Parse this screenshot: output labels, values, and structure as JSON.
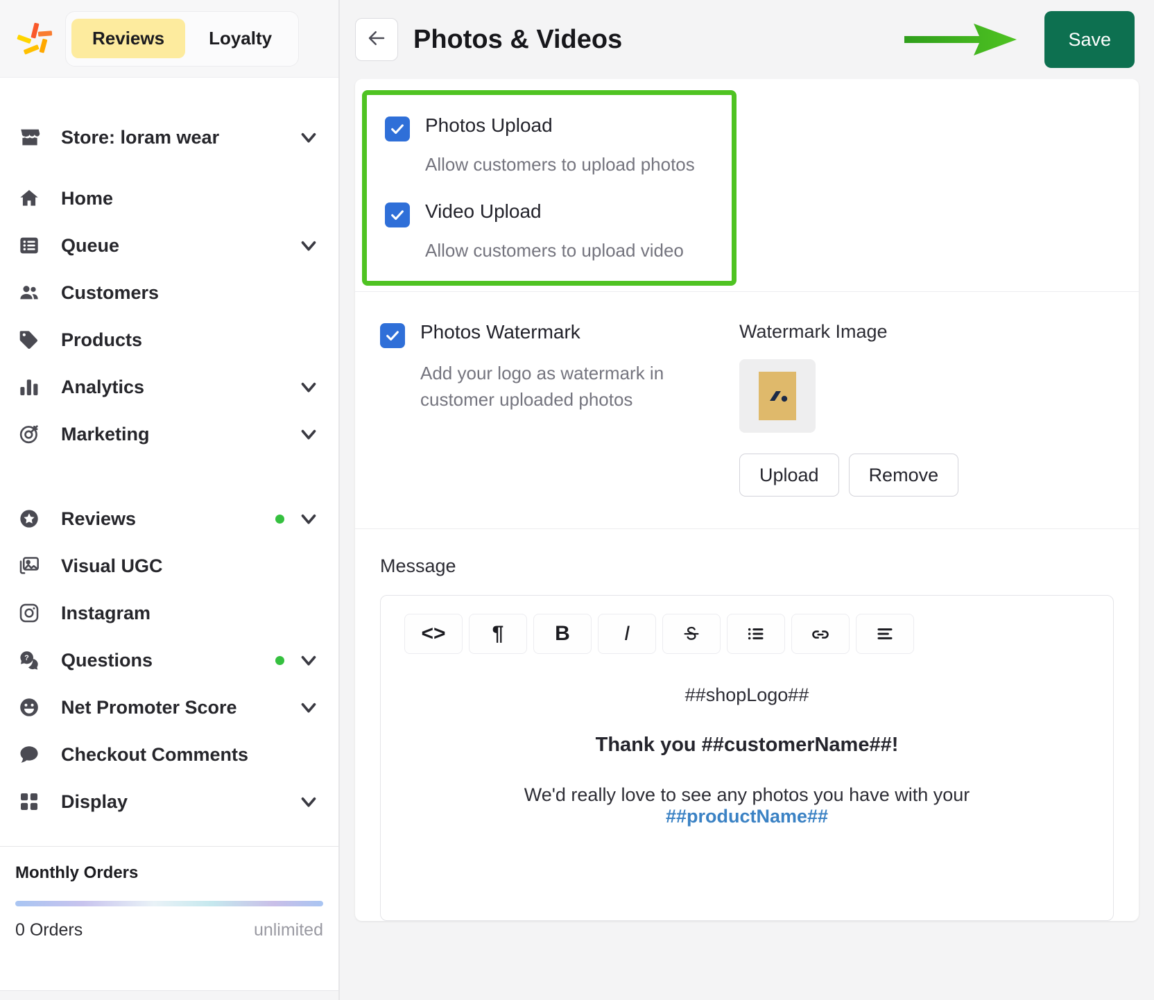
{
  "sidebar": {
    "logo_icon": "confetti-logo-icon",
    "tabs": [
      {
        "label": "Reviews",
        "active": true
      },
      {
        "label": "Loyalty",
        "active": false
      }
    ],
    "store": {
      "label": "Store: loram wear",
      "icon": "store-icon",
      "chevron": "chevron-down-icon"
    },
    "nav_primary": [
      {
        "label": "Home",
        "icon": "home-icon",
        "chevron": false,
        "dot": false
      },
      {
        "label": "Queue",
        "icon": "list-icon",
        "chevron": true,
        "dot": false
      },
      {
        "label": "Customers",
        "icon": "people-icon",
        "chevron": false,
        "dot": false
      },
      {
        "label": "Products",
        "icon": "tag-icon",
        "chevron": false,
        "dot": false
      },
      {
        "label": "Analytics",
        "icon": "bar-chart-icon",
        "chevron": true,
        "dot": false
      },
      {
        "label": "Marketing",
        "icon": "target-icon",
        "chevron": true,
        "dot": false
      }
    ],
    "nav_secondary": [
      {
        "label": "Reviews",
        "icon": "star-badge-icon",
        "chevron": true,
        "dot": true
      },
      {
        "label": "Visual UGC",
        "icon": "images-icon",
        "chevron": false,
        "dot": false
      },
      {
        "label": "Instagram",
        "icon": "instagram-icon",
        "chevron": false,
        "dot": false
      },
      {
        "label": "Questions",
        "icon": "question-bubbles-icon",
        "chevron": true,
        "dot": true
      },
      {
        "label": "Net Promoter Score",
        "icon": "smiley-icon",
        "chevron": true,
        "dot": false
      },
      {
        "label": "Checkout Comments",
        "icon": "comment-icon",
        "chevron": false,
        "dot": false
      },
      {
        "label": "Display",
        "icon": "grid-icon",
        "chevron": true,
        "dot": false
      }
    ],
    "usage": {
      "title": "Monthly Orders",
      "count": "0 Orders",
      "limit": "unlimited",
      "progress_percent": 0
    },
    "dot_color": "#35c03f",
    "active_tab_color": "#fdeb9e"
  },
  "header": {
    "back_icon": "arrow-left-icon",
    "title": "Photos & Videos",
    "save_label": "Save",
    "save_color": "#0d7050",
    "annotation_arrow": "green-pointer-arrow"
  },
  "upload_section": {
    "highlight_color": "#4fc322",
    "items": [
      {
        "label": "Photos Upload",
        "description": "Allow customers to upload photos",
        "checked": true
      },
      {
        "label": "Video Upload",
        "description": "Allow customers to upload video",
        "checked": true
      }
    ]
  },
  "watermark_section": {
    "checkbox_label": "Photos Watermark",
    "checkbox_description": "Add your logo as watermark in customer uploaded photos",
    "checked": true,
    "image_title": "Watermark Image",
    "thumbnail_icon": "watermark-thumbnail",
    "upload_label": "Upload",
    "remove_label": "Remove"
  },
  "message_section": {
    "label": "Message",
    "toolbar": [
      {
        "name": "code-icon",
        "glyph": "<>"
      },
      {
        "name": "paragraph-icon",
        "glyph": "¶"
      },
      {
        "name": "bold-icon",
        "glyph": "B"
      },
      {
        "name": "italic-icon",
        "glyph": "I"
      },
      {
        "name": "strikethrough-icon",
        "glyph": "S"
      },
      {
        "name": "bullet-list-icon",
        "glyph": ""
      },
      {
        "name": "link-icon",
        "glyph": ""
      },
      {
        "name": "align-icon",
        "glyph": ""
      }
    ],
    "body": {
      "logo_token": "##shopLogo##",
      "greeting": "Thank you ##customerName##!",
      "line1": "We'd really love to see any photos you have with your",
      "product_token": "##productName##",
      "link_color": "#3b82c4"
    }
  }
}
